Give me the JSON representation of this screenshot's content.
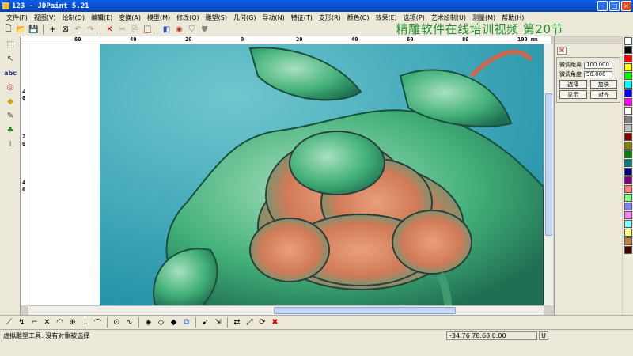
{
  "window": {
    "title": "123 - JDPaint 5.21"
  },
  "menu": [
    "文件(F)",
    "视图(V)",
    "绘制(D)",
    "编辑(E)",
    "变换(A)",
    "模型(M)",
    "修改(O)",
    "雕塑(S)",
    "几何(G)",
    "导动(N)",
    "特征(T)",
    "支形(R)",
    "颜色(C)",
    "效果(E)",
    "选项(P)",
    "艺术绘制(U)",
    "测量(M)",
    "帮助(H)"
  ],
  "watermark": "精雕软件在线培训视频  第20节",
  "ruler": {
    "h_labels": [
      "60",
      "40",
      "20",
      "0",
      "20",
      "40",
      "60",
      "80",
      "100",
      "120"
    ],
    "unit": "mm",
    "v_labels": [
      "2",
      "0",
      "2",
      "0",
      "4",
      "0"
    ]
  },
  "panel": {
    "adjust_distance_label": "微调距离",
    "adjust_distance_value": "100.000",
    "adjust_angle_label": "微调角度",
    "adjust_angle_value": "90.000",
    "select_btn": "选择",
    "speed_btn": "加快",
    "show_btn": "显示",
    "align_btn": "对齐"
  },
  "palette": [
    "#ffffff",
    "#000000",
    "#ff0000",
    "#ffff00",
    "#00ff00",
    "#00ffff",
    "#0000ff",
    "#ff00ff",
    "#ffffff",
    "#808080",
    "#c0c0c0",
    "#800000",
    "#808000",
    "#008000",
    "#008080",
    "#000080",
    "#800080",
    "#ff8080",
    "#80ff80",
    "#8080ff",
    "#ff80ff",
    "#80ffff",
    "#ffff80",
    "#c08040",
    "#400000"
  ],
  "status": {
    "message": "虚拟雕塑工具: 没有对象被选择",
    "coords": "-34.76 78.68 0.00",
    "unit": "U"
  }
}
